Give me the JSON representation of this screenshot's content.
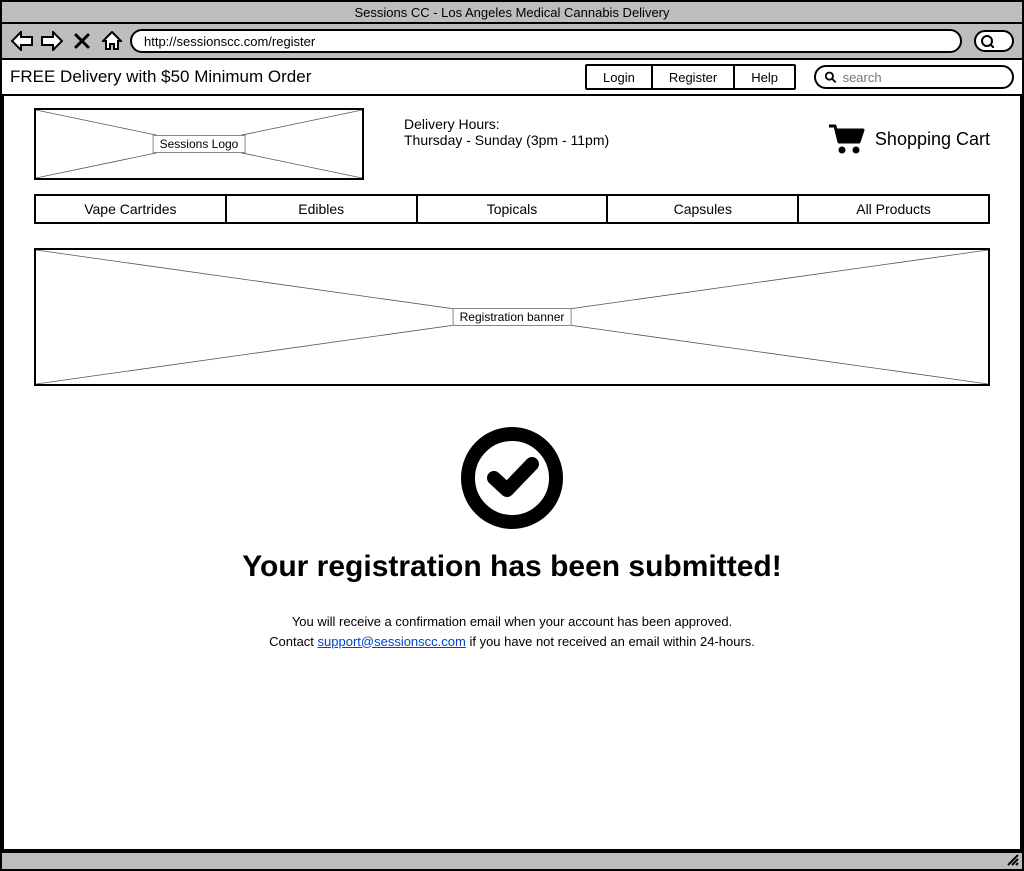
{
  "browser": {
    "title": "Sessions CC - Los Angeles Medical Cannabis Delivery",
    "url": "http://sessionscc.com/register"
  },
  "topbar": {
    "promo": "FREE Delivery with $50 Minimum Order",
    "buttons": {
      "login": "Login",
      "register": "Register",
      "help": "Help"
    },
    "search_placeholder": "search"
  },
  "header": {
    "logo_label": "Sessions Logo",
    "hours_label": "Delivery Hours:",
    "hours_detail": "Thursday - Sunday (3pm - 11pm)",
    "cart_label": "Shopping Cart"
  },
  "nav": {
    "tabs": [
      "Vape Cartrides",
      "Edibles",
      "Topicals",
      "Capsules",
      "All Products"
    ]
  },
  "banner": {
    "label": "Registration banner"
  },
  "confirmation": {
    "heading": "Your registration has been submitted!",
    "line1": "You will receive a confirmation email when your account has been approved.",
    "line2_pre": "Contact ",
    "email": "support@sessionscc.com",
    "line2_post": " if you have not received an email within 24-hours."
  }
}
